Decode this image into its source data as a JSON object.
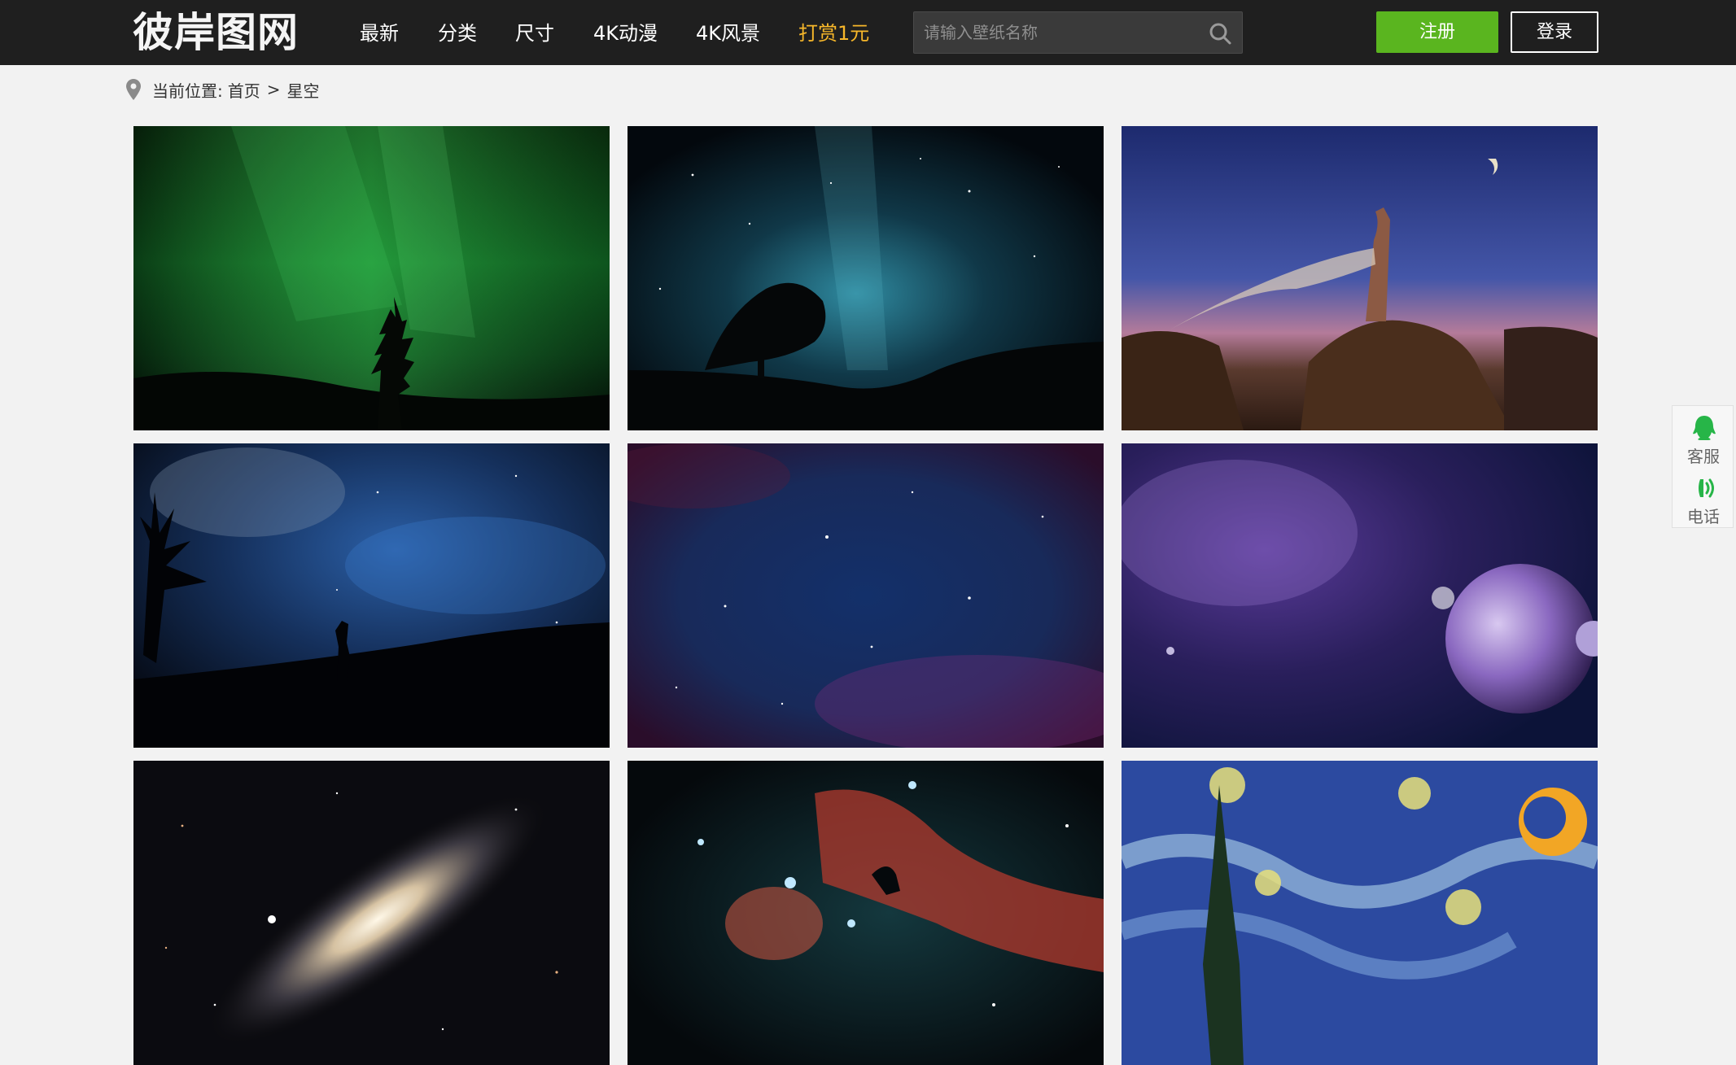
{
  "header": {
    "logo_text": "彼岸图网",
    "nav": [
      "最新",
      "分类",
      "尺寸",
      "4K动漫",
      "4K风景",
      "打赏1元"
    ],
    "search_placeholder": "请输入壁纸名称",
    "register_label": "注册",
    "login_label": "登录"
  },
  "breadcrumb": {
    "prefix": "当前位置:",
    "home": "首页",
    "separator": ">",
    "current": "星空"
  },
  "float_service": {
    "qq_label": "客服",
    "phone_label": "电话"
  },
  "colors": {
    "header_bg": "#1f1f1f",
    "register_green": "#5ab51f",
    "highlight_orange": "#f7b72a",
    "page_bg": "#f2f2f2",
    "service_green": "#27b548"
  },
  "wallpapers": [
    {
      "subject": "aurora-tree"
    },
    {
      "subject": "milky-way-tree"
    },
    {
      "subject": "woman-on-rock"
    },
    {
      "subject": "couple-silhouette-night"
    },
    {
      "subject": "starfield-nebula"
    },
    {
      "subject": "purple-planet"
    },
    {
      "subject": "andromeda-galaxy"
    },
    {
      "subject": "horsehead-nebula"
    },
    {
      "subject": "starry-night-painting"
    }
  ]
}
